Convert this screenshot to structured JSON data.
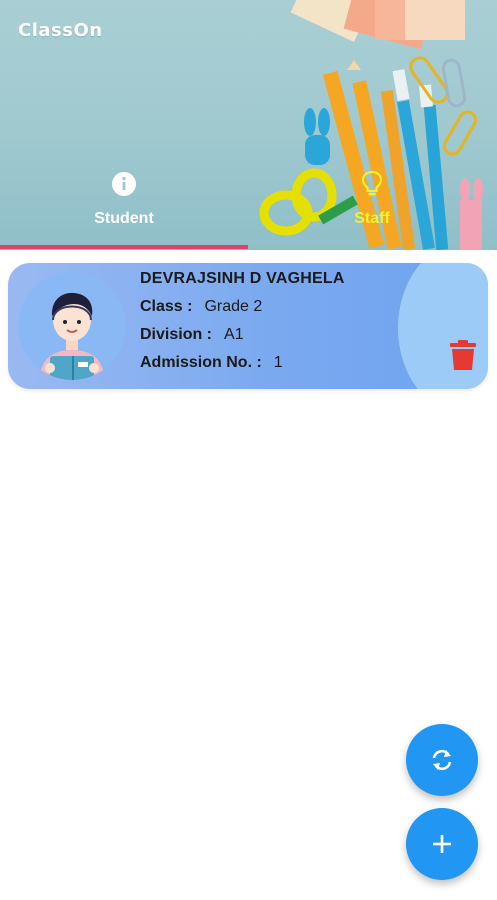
{
  "app": {
    "logo_text": "ClassOn"
  },
  "tabs": [
    {
      "label": "Student",
      "icon": "info-icon",
      "selected": true
    },
    {
      "label": "Staff",
      "icon": "lightbulb-icon",
      "selected": false
    }
  ],
  "colors": {
    "tab_indicator": "#e0406a",
    "staff_label": "#f5f22a",
    "card_gradient_start": "#9ab9f2",
    "card_gradient_end": "#6fa3f0",
    "delete": "#e53935",
    "fab": "#2196f3"
  },
  "student_card": {
    "name": "DEVRAJSINH D VAGHELA",
    "class_label": "Class :",
    "class_value": "Grade 2",
    "division_label": "Division :",
    "division_value": "A1",
    "admission_label": "Admission No. :",
    "admission_value": "1",
    "delete_icon": "trash-icon",
    "avatar_icon": "student-avatar-icon"
  },
  "fabs": [
    {
      "icon": "refresh-icon"
    },
    {
      "icon": "add-icon"
    }
  ]
}
